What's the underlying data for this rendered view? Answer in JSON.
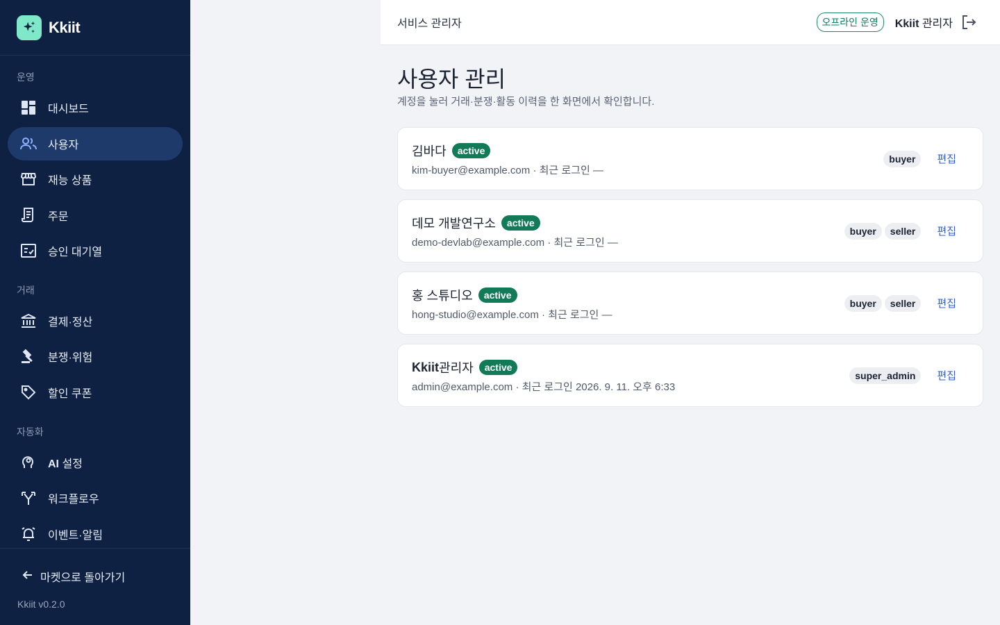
{
  "brand": {
    "name": "Kkiit",
    "logo_icon": "sparkles-icon",
    "accent": "#7ee8c8"
  },
  "sidebar": {
    "sections": [
      "운영",
      "거래",
      "자동화"
    ],
    "items": [
      {
        "label": "대시보드",
        "icon": "dashboard-icon"
      },
      {
        "label": "사용자",
        "icon": "users-icon",
        "active": true
      },
      {
        "label": "재능 상품",
        "icon": "storefront-icon"
      },
      {
        "label": "주문",
        "icon": "receipt-icon"
      },
      {
        "label": "승인 대기열",
        "icon": "checklist-icon"
      },
      {
        "label": "결제·정산",
        "icon": "bank-icon"
      },
      {
        "label": "분쟁·위험",
        "icon": "gavel-icon"
      },
      {
        "label": "할인 쿠폰",
        "icon": "tag-icon"
      },
      {
        "label_bold": "AI",
        "label_rest": " 설정",
        "icon": "ai-head-icon"
      },
      {
        "label": "워크플로우",
        "icon": "branch-icon"
      },
      {
        "label": "이벤트·알림",
        "icon": "alarm-icon"
      }
    ],
    "back_label": "마켓으로 돌아가기",
    "version": "Kkiit v0.2.0"
  },
  "topbar": {
    "title": "서비스 관리자",
    "offline_badge": "오프라인 운영",
    "admin_bold": "Kkiit",
    "admin_rest": " 관리자"
  },
  "page": {
    "title": "사용자 관리",
    "subtitle": "계정을 눌러 거래·분쟁·활동 이력을 한 화면에서 확인합니다."
  },
  "users": [
    {
      "name_bold": "",
      "name": "김바다",
      "status": "active",
      "email": "kim-buyer@example.com",
      "last_login": " · 최근 로그인 —",
      "roles": [
        "buyer"
      ],
      "edit_label": "편집"
    },
    {
      "name_bold": "",
      "name": "데모 개발연구소",
      "status": "active",
      "email": "demo-devlab@example.com",
      "last_login": " · 최근 로그인 —",
      "roles": [
        "buyer",
        "seller"
      ],
      "edit_label": "편집"
    },
    {
      "name_bold": "",
      "name": "홍 스튜디오",
      "status": "active",
      "email": "hong-studio@example.com",
      "last_login": " · 최근 로그인 —",
      "roles": [
        "buyer",
        "seller"
      ],
      "edit_label": "편집"
    },
    {
      "name_bold": "Kkiit",
      "name": " 관리자",
      "status": "active",
      "email": "admin@example.com",
      "last_login": " · 최근 로그인 2026. 9. 11. 오후 6:33",
      "roles": [
        "super_admin"
      ],
      "edit_label": "편집"
    }
  ]
}
